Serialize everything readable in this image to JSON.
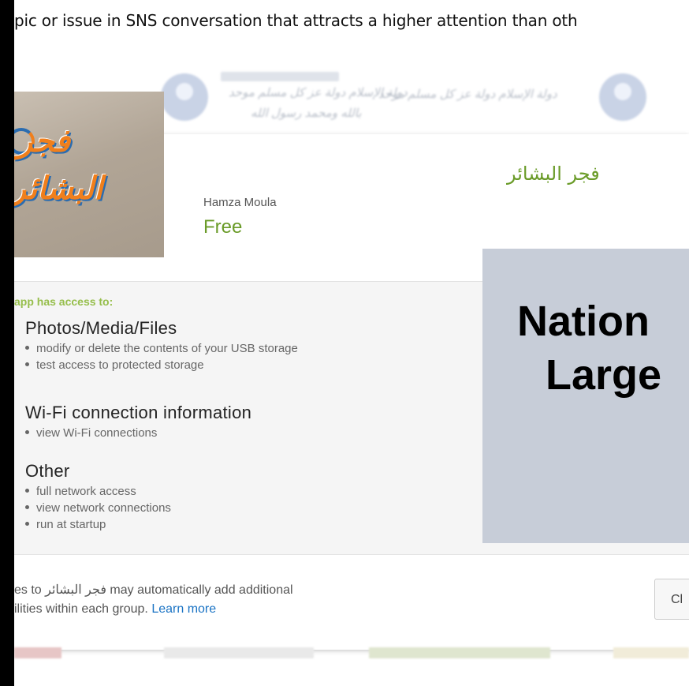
{
  "headline": "pic or issue in SNS conversation that attracts a higher attention than oth",
  "background_text": {
    "line1": "دولة الإسلام دولة عز كل مسلم موحد",
    "line2": "دولة الإسلام دولة عز كل مسلم موحد",
    "line3": "بالله ومحمد رسول الله"
  },
  "app": {
    "icon_label_top": "فجر",
    "icon_label_bottom": "البشائر",
    "name": "فجر البشائر",
    "developer": "Hamza Moula",
    "price": "Free"
  },
  "permissions": {
    "heading": "app has access to:",
    "groups": [
      {
        "title": "Photos/Media/Files",
        "items": [
          "modify or delete the contents of your USB storage",
          "test access to protected storage"
        ]
      },
      {
        "title": "Wi-Fi connection information",
        "items": [
          "view Wi-Fi connections"
        ]
      },
      {
        "title": "Other",
        "items": [
          "full network access",
          "view network connections",
          "run at startup"
        ]
      }
    ]
  },
  "footer": {
    "note_line1": "es to فجر البشائر may automatically add additional",
    "note_line2_prefix": "ilities within each group.",
    "learn_more": "Learn more",
    "close_button": "Cl"
  },
  "overlay": {
    "line1": "Nation",
    "line2": "Large"
  },
  "colors": {
    "accent_green": "#6a9b28",
    "heading_green": "#96be4b",
    "link_blue": "#1a73c4",
    "overlay_bg": "#c7cdd8"
  }
}
